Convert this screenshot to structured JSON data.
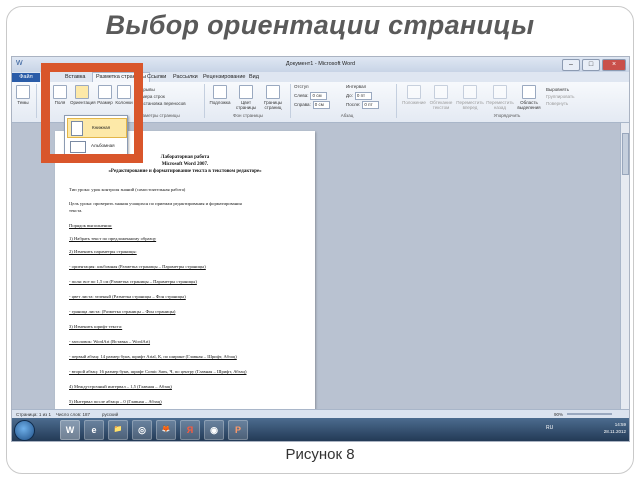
{
  "slide": {
    "title": "Выбор ориентации страницы",
    "caption": "Рисунок 8"
  },
  "word": {
    "titlebar": {
      "document": "Документ1 - Microsoft Word",
      "qat": "W"
    },
    "tabs": [
      {
        "label": "Файл"
      },
      {
        "label": "Вставка"
      },
      {
        "label": "Разметка страницы"
      },
      {
        "label": "Ссылки"
      },
      {
        "label": "Рассылки"
      },
      {
        "label": "Рецензирование"
      },
      {
        "label": "Вид"
      }
    ],
    "ribbon": {
      "themes": "Темы",
      "fields": "Поля",
      "orientation": "Ориентация",
      "size": "Размер",
      "columns": "Колонки",
      "breaks": "Разрывы",
      "line_numbers": "Номера строк",
      "hyphenation": "Расстановка переносов",
      "page_setup_group": "Параметры страницы",
      "watermark": "Подложка",
      "page_color": "Цвет страницы",
      "page_borders": "Границы страниц",
      "background_group": "Фон страницы",
      "indent": "Отступ",
      "indent_left_label": "Слева:",
      "indent_left": "0 см",
      "indent_right_label": "Справа:",
      "indent_right": "0 см",
      "spacing": "Интервал",
      "spacing_before_label": "До:",
      "spacing_before": "0 пт",
      "spacing_after_label": "После:",
      "spacing_after": "0 пт",
      "paragraph_group": "Абзац",
      "position": "Положение",
      "wrap_text": "Обтекание текстом",
      "bring_forward": "Переместить вперед",
      "send_backward": "Переместить назад",
      "selection_pane": "Область выделения",
      "align": "Выровнять",
      "group": "Группировать",
      "rotate": "Повернуть",
      "arrange_group": "Упорядочить"
    },
    "orientation_menu": [
      {
        "label": "Книжная"
      },
      {
        "label": "Альбомная"
      }
    ],
    "document_lines": [
      {
        "text": "Лабораторная работа",
        "style": "h"
      },
      {
        "text": "Microsoft Word 2007.",
        "style": "h"
      },
      {
        "text": "«Редактирование и форматирование текста в текстовом редакторе»",
        "style": "h"
      },
      {
        "text": "Тип урока: урок контроля знаний (самостоятельная работа)",
        "style": "p"
      },
      {
        "text": "Цель урока: проверить знания учащихся по приемам редактирования и форматирования",
        "style": "p"
      },
      {
        "text": "текста.",
        "style": "p"
      },
      {
        "text": "Порядок выполнения:",
        "style": "pu"
      },
      {
        "text": "1) Набрать текст по предложенному образцу",
        "style": "pu"
      },
      {
        "text": "2) Изменить параметры страницы:",
        "style": "pu"
      },
      {
        "text": "- ориентация: альбомная (Разметка страницы – Параметры страницы)",
        "style": "pu"
      },
      {
        "text": "- поля: все по 1,5 см (Разметка страницы – Параметры страницы)",
        "style": "pu"
      },
      {
        "text": "- цвет листа: зеленый (Разметка страницы – Фон страницы)",
        "style": "pu"
      },
      {
        "text": "- граница листа: (Разметка страницы – Фон страницы)",
        "style": "pu"
      },
      {
        "text": "3) Изменить шрифт текста:",
        "style": "pu"
      },
      {
        "text": "- заголовок: WordArt (Вставка – WordArt)",
        "style": "pu"
      },
      {
        "text": "- первый абзац: 14 размер букв, шрифт Arial, К, по ширине (Главная – Шрифт, Абзац)",
        "style": "pu"
      },
      {
        "text": "- второй абзац: 16 размер букв, шрифт Comic Sans, Ч, по центру (Главная – Шрифт, Абзац)",
        "style": "pu"
      },
      {
        "text": "4) Междустрочный интервал – 1,5 (Главная – Абзац)",
        "style": "pu"
      },
      {
        "text": "5) Интервал после абзаца – 0 (Главная – Абзац)",
        "style": "pu"
      }
    ],
    "statusbar": {
      "page": "Страница: 1 из 1",
      "words": "Число слов: 187",
      "language": "русский",
      "zoom": "90%"
    },
    "taskbar": {
      "time": "14:59",
      "date": "28.11.2012",
      "lang": "RU",
      "apps": [
        "W",
        "e",
        "📁",
        "◎",
        "🦊",
        "Я",
        "◉",
        "P"
      ]
    },
    "colors": {
      "highlight": "#d9562b",
      "file_tab": "#2a5ca8",
      "taskbar": "#233a56"
    }
  }
}
